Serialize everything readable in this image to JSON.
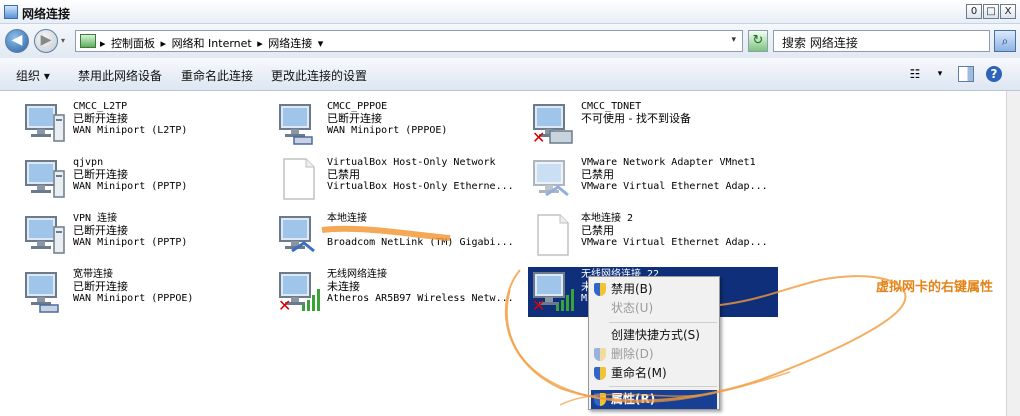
{
  "window": {
    "title": "网络连接",
    "minimize": "0",
    "maximize": "□",
    "close": "X"
  },
  "address": {
    "crumbs": [
      "控制面板",
      "网络和 Internet",
      "网络连接"
    ],
    "separator": "▸",
    "dropdown": "▾",
    "search_placeholder": "搜索 网络连接"
  },
  "toolbar": {
    "organize": "组织 ▾",
    "disable": "禁用此网络设备",
    "rename": "重命名此连接",
    "change_settings": "更改此连接的设置"
  },
  "connections": [
    {
      "name": "CMCC_L2TP",
      "status": "已断开连接",
      "device": "WAN Miniport (L2TP)",
      "icon": "dialup-connection-icon"
    },
    {
      "name": "CMCC_PPPOE",
      "status": "已断开连接",
      "device": "WAN Miniport (PPPOE)",
      "icon": "broadband-connection-icon"
    },
    {
      "name": "CMCC_TDNET",
      "status": "不可使用 - 找不到设备",
      "device": "",
      "icon": "dialup-unavailable-icon"
    },
    {
      "name": "qjvpn",
      "status": "已断开连接",
      "device": "WAN Miniport (PPTP)",
      "icon": "vpn-connection-icon"
    },
    {
      "name": "VirtualBox Host-Only Network",
      "status": "已禁用",
      "device": "VirtualBox Host-Only Etherne...",
      "icon": "blank-document-icon"
    },
    {
      "name": "VMware Network Adapter VMnet1",
      "status": "已禁用",
      "device": "VMware Virtual Ethernet Adap...",
      "icon": "lan-disabled-icon"
    },
    {
      "name": "VPN 连接",
      "status": "已断开连接",
      "device": "WAN Miniport (PPTP)",
      "icon": "vpn-connection-icon"
    },
    {
      "name": "本地连接",
      "status": "",
      "device": "Broadcom NetLink (TM) Gigabi...",
      "icon": "lan-connected-icon"
    },
    {
      "name": "本地连接 2",
      "status": "已禁用",
      "device": "VMware Virtual Ethernet Adap...",
      "icon": "blank-document-icon"
    },
    {
      "name": "宽带连接",
      "status": "已断开连接",
      "device": "WAN Miniport (PPPOE)",
      "icon": "broadband-connection-icon"
    },
    {
      "name": "无线网络连接",
      "status": "未连接",
      "device": "Atheros AR5B97 Wireless Netw...",
      "icon": "wireless-disconnected-icon"
    },
    {
      "name": "无线网络连接 22",
      "status": "未",
      "device": "Minip...",
      "icon": "wireless-disconnected-icon"
    }
  ],
  "context_menu": {
    "items": [
      {
        "label": "禁用(B)",
        "enabled": true,
        "shield": true
      },
      {
        "label": "状态(U)",
        "enabled": false,
        "shield": false
      },
      {
        "label": "创建快捷方式(S)",
        "enabled": true,
        "shield": false
      },
      {
        "label": "删除(D)",
        "enabled": false,
        "shield": true
      },
      {
        "label": "重命名(M)",
        "enabled": true,
        "shield": true
      },
      {
        "label": "属性(R)",
        "enabled": true,
        "shield": true,
        "highlighted": true
      }
    ]
  },
  "annotation": "虚拟网卡的右键属性",
  "colors": {
    "selection": "#0f2f7a",
    "annotation": "#e2841a",
    "menu_highlight": "#173f93"
  }
}
